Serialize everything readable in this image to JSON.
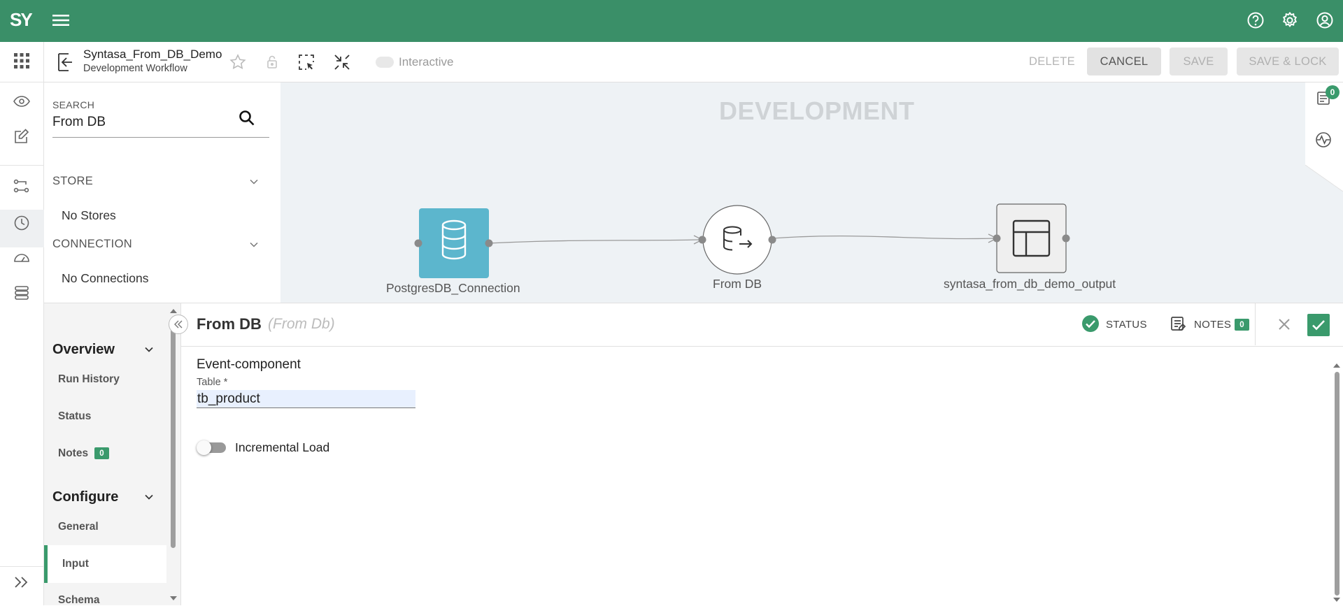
{
  "app": {
    "logo_text": "SY",
    "accent_color": "#3a8f68",
    "top_icons": [
      "menu-icon",
      "help-icon",
      "gear-icon",
      "user-account-icon"
    ]
  },
  "header": {
    "workflow_title": "Syntasa_From_DB_Demo",
    "workflow_subtitle": "Development Workflow",
    "interactive_label": "Interactive",
    "interactive_enabled": false,
    "delete_label": "DELETE",
    "cancel_label": "CANCEL",
    "save_label": "SAVE",
    "save_lock_label": "SAVE & LOCK"
  },
  "library": {
    "search_label": "SEARCH",
    "search_value": "From DB",
    "sections": [
      {
        "title": "STORE",
        "empty_text": "No Stores"
      },
      {
        "title": "CONNECTION",
        "empty_text": "No Connections"
      }
    ]
  },
  "canvas": {
    "title": "DEVELOPMENT",
    "notes_count": "0",
    "nodes": [
      {
        "label": "PostgresDB_Connection",
        "icon": "database-icon"
      },
      {
        "label": "From DB",
        "icon": "database-export-icon"
      },
      {
        "label": "syntasa_from_db_demo_output",
        "icon": "table-layout-icon"
      }
    ]
  },
  "nav": {
    "overview_title": "Overview",
    "overview_items": [
      "Run History",
      "Status",
      "Notes"
    ],
    "notes_count": "0",
    "configure_title": "Configure",
    "configure_items": [
      "General",
      "Input",
      "Schema"
    ],
    "active_item": "Input"
  },
  "detail": {
    "title": "From DB",
    "type": "(From Db)",
    "status_label": "STATUS",
    "notes_label": "NOTES",
    "notes_count": "0",
    "section_title": "Event-component",
    "table_label": "Table *",
    "table_value": "tb_product",
    "incremental_label": "Incremental Load",
    "incremental_enabled": false
  }
}
